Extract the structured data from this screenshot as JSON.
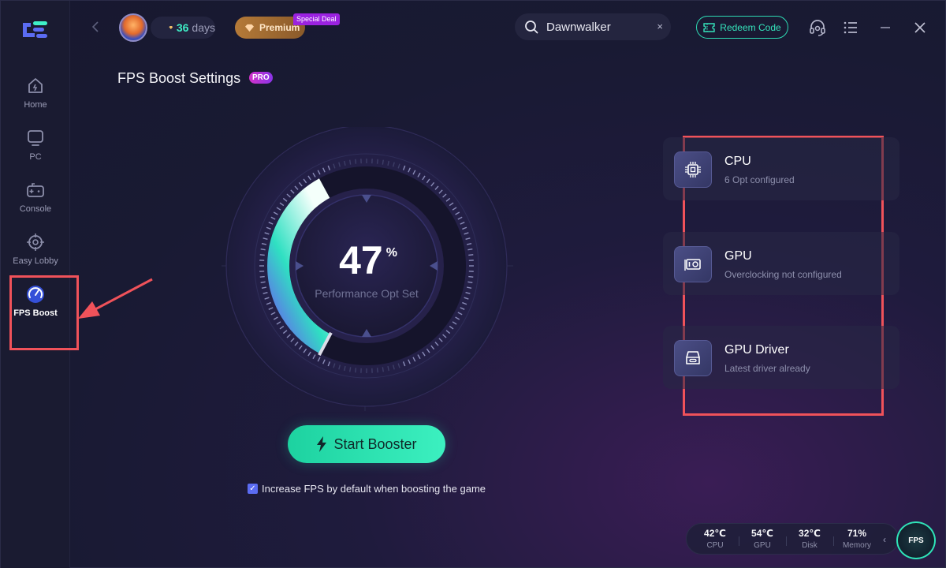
{
  "sidebar": {
    "items": [
      {
        "label": "Home",
        "icon": "home-icon"
      },
      {
        "label": "PC",
        "icon": "monitor-icon"
      },
      {
        "label": "Console",
        "icon": "gamepad-icon"
      },
      {
        "label": "Easy Lobby",
        "icon": "crosshair-icon"
      },
      {
        "label": "FPS Boost",
        "icon": "speedometer-icon",
        "active": true
      }
    ]
  },
  "header": {
    "days_value": "36",
    "days_unit": "days",
    "premium_label": "Premium",
    "special_label": "Special Deal",
    "search_value": "Dawnwalker",
    "search_clear": "×",
    "redeem_label": "Redeem Code"
  },
  "page": {
    "title": "FPS Boost Settings",
    "pro_badge": "PRO"
  },
  "gauge": {
    "value": "47",
    "unit": "%",
    "label": "Performance Opt Set",
    "fraction": 0.47
  },
  "booster": {
    "button_label": "Start Booster",
    "checkbox_label": "Increase FPS by default when boosting the game",
    "checked": true
  },
  "cards": [
    {
      "title": "CPU",
      "subtitle": "6 Opt configured",
      "icon": "cpu-icon"
    },
    {
      "title": "GPU",
      "subtitle": "Overclocking not configured",
      "icon": "gpu-icon"
    },
    {
      "title": "GPU Driver",
      "subtitle": "Latest driver already",
      "icon": "driver-icon"
    }
  ],
  "stats": [
    {
      "value": "42℃",
      "label": "CPU"
    },
    {
      "value": "54℃",
      "label": "GPU"
    },
    {
      "value": "32℃",
      "label": "Disk"
    },
    {
      "value": "71%",
      "label": "Memory"
    }
  ],
  "fps_badge": "FPS",
  "colors": {
    "accent": "#2ed9b2",
    "annotation": "#f0525a",
    "background": "#17182f"
  }
}
